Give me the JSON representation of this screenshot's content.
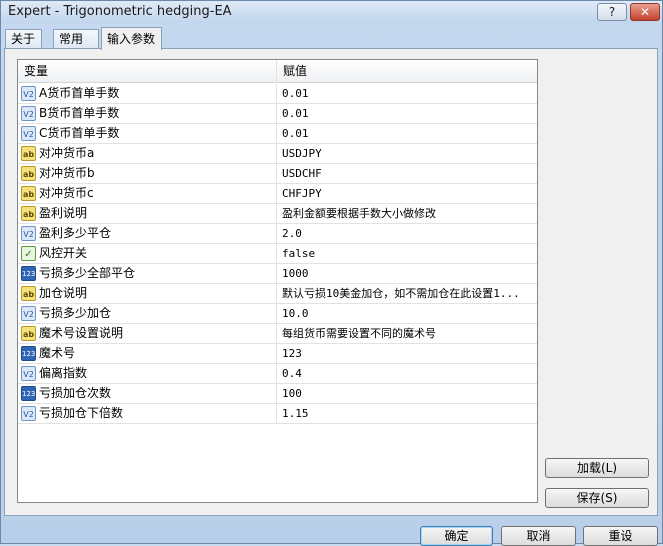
{
  "window": {
    "title": "Expert - Trigonometric hedging-EA",
    "help_label": "?",
    "close_label": "✕"
  },
  "tabs": [
    "关于",
    "常用",
    "输入参数"
  ],
  "grid": {
    "col_variable": "变量",
    "col_value": "赋值",
    "rows": [
      {
        "icon": "v2",
        "name": "A货币首单手数",
        "value": "0.01"
      },
      {
        "icon": "v2",
        "name": "B货币首单手数",
        "value": "0.01"
      },
      {
        "icon": "v2",
        "name": "C货币首单手数",
        "value": "0.01"
      },
      {
        "icon": "ab",
        "name": "对冲货币a",
        "value": "USDJPY"
      },
      {
        "icon": "ab",
        "name": "对冲货币b",
        "value": "USDCHF"
      },
      {
        "icon": "ab",
        "name": "对冲货币c",
        "value": "CHFJPY"
      },
      {
        "icon": "ab",
        "name": "盈利说明",
        "value": "盈利金额要根据手数大小做修改"
      },
      {
        "icon": "v2",
        "name": "盈利多少平仓",
        "value": "2.0"
      },
      {
        "icon": "bool",
        "name": "风控开关",
        "value": "false"
      },
      {
        "icon": "n123",
        "name": "亏损多少全部平仓",
        "value": "1000"
      },
      {
        "icon": "ab",
        "name": "加仓说明",
        "value": "默认亏损10美金加仓，如不需加仓在此设置1..."
      },
      {
        "icon": "v2",
        "name": "亏损多少加仓",
        "value": "10.0"
      },
      {
        "icon": "ab",
        "name": "魔术号设置说明",
        "value": "每组货币需要设置不同的魔术号"
      },
      {
        "icon": "n123",
        "name": "魔术号",
        "value": "123"
      },
      {
        "icon": "v2",
        "name": "偏离指数",
        "value": "0.4"
      },
      {
        "icon": "n123",
        "name": "亏损加仓次数",
        "value": "100"
      },
      {
        "icon": "v2",
        "name": "亏损加仓下倍数",
        "value": "1.15"
      }
    ]
  },
  "buttons": {
    "load": "加载(L)",
    "save": "保存(S)",
    "ok": "确定",
    "cancel": "取消",
    "reset": "重设"
  }
}
